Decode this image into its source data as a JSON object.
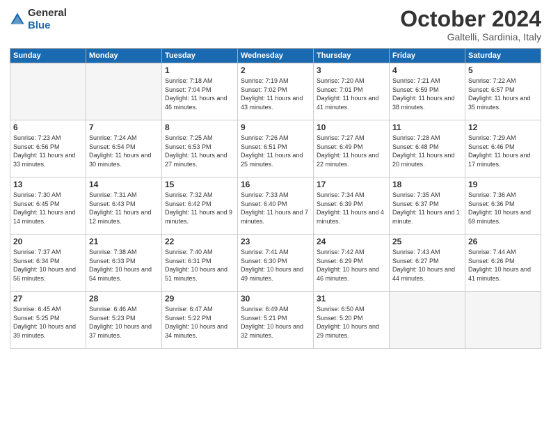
{
  "header": {
    "logo": {
      "general": "General",
      "blue": "Blue"
    },
    "month": "October 2024",
    "location": "Galtelli, Sardinia, Italy"
  },
  "weekdays": [
    "Sunday",
    "Monday",
    "Tuesday",
    "Wednesday",
    "Thursday",
    "Friday",
    "Saturday"
  ],
  "weeks": [
    [
      {
        "day": null,
        "empty": true
      },
      {
        "day": null,
        "empty": true
      },
      {
        "day": "1",
        "sunrise": "Sunrise: 7:18 AM",
        "sunset": "Sunset: 7:04 PM",
        "daylight": "Daylight: 11 hours and 46 minutes."
      },
      {
        "day": "2",
        "sunrise": "Sunrise: 7:19 AM",
        "sunset": "Sunset: 7:02 PM",
        "daylight": "Daylight: 11 hours and 43 minutes."
      },
      {
        "day": "3",
        "sunrise": "Sunrise: 7:20 AM",
        "sunset": "Sunset: 7:01 PM",
        "daylight": "Daylight: 11 hours and 41 minutes."
      },
      {
        "day": "4",
        "sunrise": "Sunrise: 7:21 AM",
        "sunset": "Sunset: 6:59 PM",
        "daylight": "Daylight: 11 hours and 38 minutes."
      },
      {
        "day": "5",
        "sunrise": "Sunrise: 7:22 AM",
        "sunset": "Sunset: 6:57 PM",
        "daylight": "Daylight: 11 hours and 35 minutes."
      }
    ],
    [
      {
        "day": "6",
        "sunrise": "Sunrise: 7:23 AM",
        "sunset": "Sunset: 6:56 PM",
        "daylight": "Daylight: 11 hours and 33 minutes."
      },
      {
        "day": "7",
        "sunrise": "Sunrise: 7:24 AM",
        "sunset": "Sunset: 6:54 PM",
        "daylight": "Daylight: 11 hours and 30 minutes."
      },
      {
        "day": "8",
        "sunrise": "Sunrise: 7:25 AM",
        "sunset": "Sunset: 6:53 PM",
        "daylight": "Daylight: 11 hours and 27 minutes."
      },
      {
        "day": "9",
        "sunrise": "Sunrise: 7:26 AM",
        "sunset": "Sunset: 6:51 PM",
        "daylight": "Daylight: 11 hours and 25 minutes."
      },
      {
        "day": "10",
        "sunrise": "Sunrise: 7:27 AM",
        "sunset": "Sunset: 6:49 PM",
        "daylight": "Daylight: 11 hours and 22 minutes."
      },
      {
        "day": "11",
        "sunrise": "Sunrise: 7:28 AM",
        "sunset": "Sunset: 6:48 PM",
        "daylight": "Daylight: 11 hours and 20 minutes."
      },
      {
        "day": "12",
        "sunrise": "Sunrise: 7:29 AM",
        "sunset": "Sunset: 6:46 PM",
        "daylight": "Daylight: 11 hours and 17 minutes."
      }
    ],
    [
      {
        "day": "13",
        "sunrise": "Sunrise: 7:30 AM",
        "sunset": "Sunset: 6:45 PM",
        "daylight": "Daylight: 11 hours and 14 minutes."
      },
      {
        "day": "14",
        "sunrise": "Sunrise: 7:31 AM",
        "sunset": "Sunset: 6:43 PM",
        "daylight": "Daylight: 11 hours and 12 minutes."
      },
      {
        "day": "15",
        "sunrise": "Sunrise: 7:32 AM",
        "sunset": "Sunset: 6:42 PM",
        "daylight": "Daylight: 11 hours and 9 minutes."
      },
      {
        "day": "16",
        "sunrise": "Sunrise: 7:33 AM",
        "sunset": "Sunset: 6:40 PM",
        "daylight": "Daylight: 11 hours and 7 minutes."
      },
      {
        "day": "17",
        "sunrise": "Sunrise: 7:34 AM",
        "sunset": "Sunset: 6:39 PM",
        "daylight": "Daylight: 11 hours and 4 minutes."
      },
      {
        "day": "18",
        "sunrise": "Sunrise: 7:35 AM",
        "sunset": "Sunset: 6:37 PM",
        "daylight": "Daylight: 11 hours and 1 minute."
      },
      {
        "day": "19",
        "sunrise": "Sunrise: 7:36 AM",
        "sunset": "Sunset: 6:36 PM",
        "daylight": "Daylight: 10 hours and 59 minutes."
      }
    ],
    [
      {
        "day": "20",
        "sunrise": "Sunrise: 7:37 AM",
        "sunset": "Sunset: 6:34 PM",
        "daylight": "Daylight: 10 hours and 56 minutes."
      },
      {
        "day": "21",
        "sunrise": "Sunrise: 7:38 AM",
        "sunset": "Sunset: 6:33 PM",
        "daylight": "Daylight: 10 hours and 54 minutes."
      },
      {
        "day": "22",
        "sunrise": "Sunrise: 7:40 AM",
        "sunset": "Sunset: 6:31 PM",
        "daylight": "Daylight: 10 hours and 51 minutes."
      },
      {
        "day": "23",
        "sunrise": "Sunrise: 7:41 AM",
        "sunset": "Sunset: 6:30 PM",
        "daylight": "Daylight: 10 hours and 49 minutes."
      },
      {
        "day": "24",
        "sunrise": "Sunrise: 7:42 AM",
        "sunset": "Sunset: 6:29 PM",
        "daylight": "Daylight: 10 hours and 46 minutes."
      },
      {
        "day": "25",
        "sunrise": "Sunrise: 7:43 AM",
        "sunset": "Sunset: 6:27 PM",
        "daylight": "Daylight: 10 hours and 44 minutes."
      },
      {
        "day": "26",
        "sunrise": "Sunrise: 7:44 AM",
        "sunset": "Sunset: 6:26 PM",
        "daylight": "Daylight: 10 hours and 41 minutes."
      }
    ],
    [
      {
        "day": "27",
        "sunrise": "Sunrise: 6:45 AM",
        "sunset": "Sunset: 5:25 PM",
        "daylight": "Daylight: 10 hours and 39 minutes."
      },
      {
        "day": "28",
        "sunrise": "Sunrise: 6:46 AM",
        "sunset": "Sunset: 5:23 PM",
        "daylight": "Daylight: 10 hours and 37 minutes."
      },
      {
        "day": "29",
        "sunrise": "Sunrise: 6:47 AM",
        "sunset": "Sunset: 5:22 PM",
        "daylight": "Daylight: 10 hours and 34 minutes."
      },
      {
        "day": "30",
        "sunrise": "Sunrise: 6:49 AM",
        "sunset": "Sunset: 5:21 PM",
        "daylight": "Daylight: 10 hours and 32 minutes."
      },
      {
        "day": "31",
        "sunrise": "Sunrise: 6:50 AM",
        "sunset": "Sunset: 5:20 PM",
        "daylight": "Daylight: 10 hours and 29 minutes."
      },
      {
        "day": null,
        "empty": true
      },
      {
        "day": null,
        "empty": true
      }
    ]
  ]
}
